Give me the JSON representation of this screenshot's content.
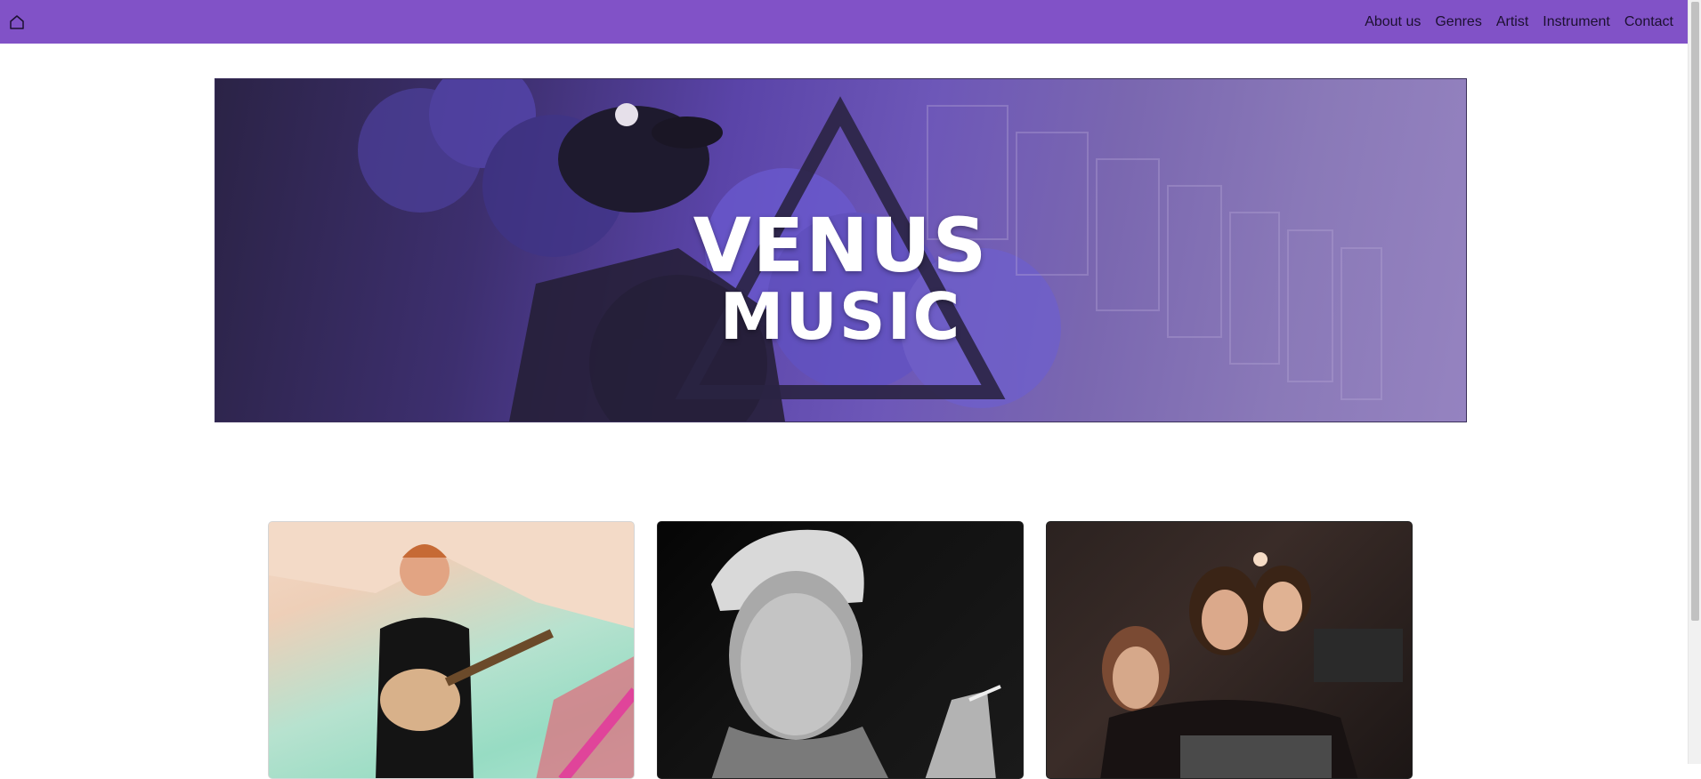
{
  "nav": {
    "home_icon": "home-icon",
    "links": [
      "About us",
      "Genres",
      "Artist",
      "Instrument",
      "Contact"
    ]
  },
  "hero": {
    "line1": "VENUS",
    "line2": "MUSIC"
  },
  "colors": {
    "navbar": "#8152c7",
    "accent": "#6d57b8"
  }
}
